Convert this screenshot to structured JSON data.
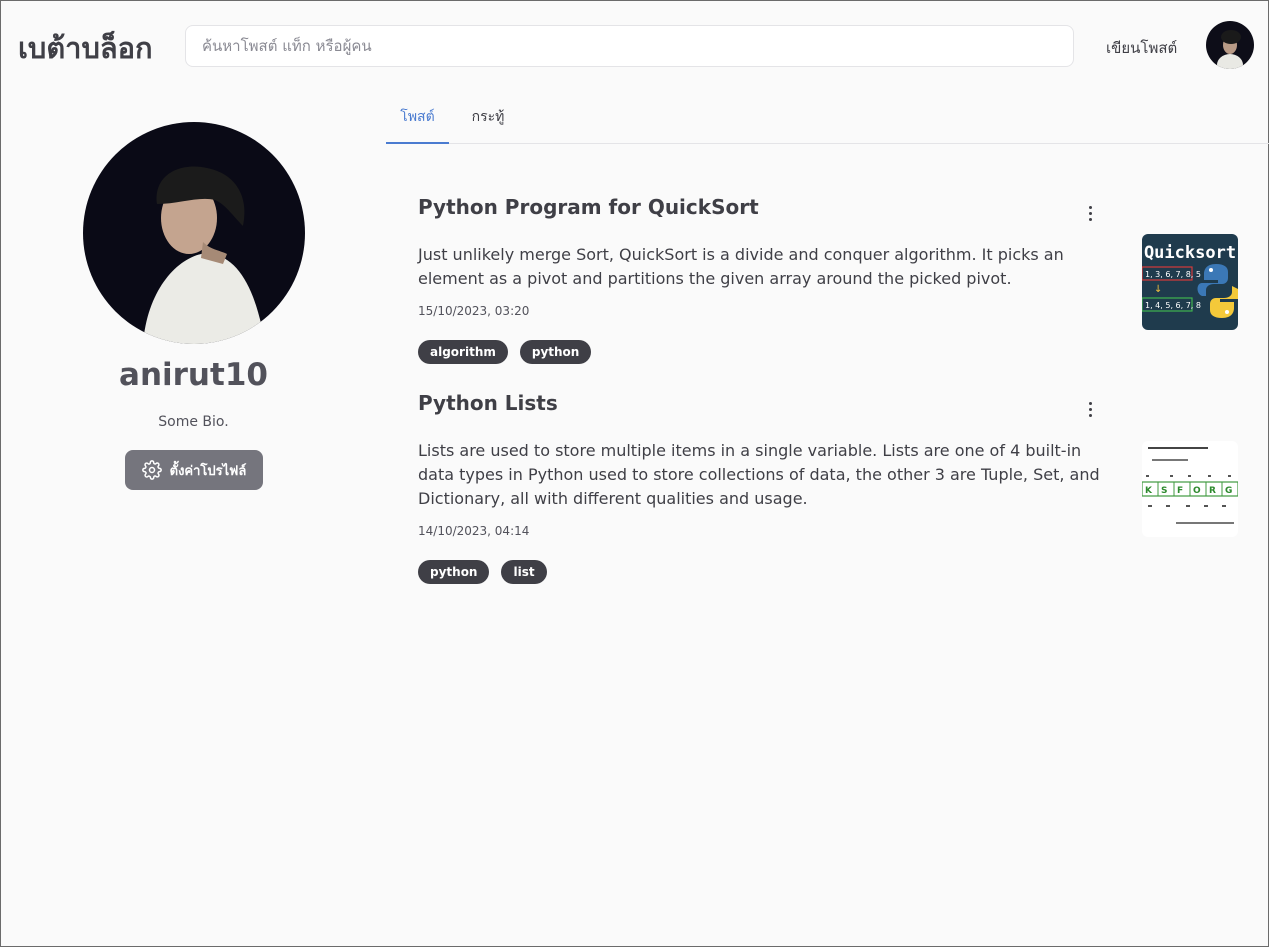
{
  "header": {
    "brand": "เบต้าบล็อก",
    "search_placeholder": "ค้นหาโพสต์ แท็ก หรือผู้คน",
    "write_label": "เขียนโพสต์"
  },
  "profile": {
    "username": "anirut10",
    "bio": "Some Bio.",
    "settings_label": "ตั้งค่าโปรไฟล์"
  },
  "tabs": [
    {
      "label": "โพสต์",
      "active": true
    },
    {
      "label": "กระทู้",
      "active": false
    }
  ],
  "posts": [
    {
      "title": "Python Program for QuickSort",
      "excerpt": "Just unlikely merge Sort, QuickSort is a divide and conquer algorithm. It picks an element as a pivot and partitions the given array around the picked pivot.",
      "date": "15/10/2023, 03:20",
      "tags": [
        "algorithm",
        "python"
      ],
      "thumbnail": {
        "title": "Quicksort",
        "row_top": "1, 3, 6, 7, 8, 5",
        "row_bottom": "1, 4, 5, 6, 7, 8"
      }
    },
    {
      "title": "Python Lists",
      "excerpt": "Lists are used to store multiple items in a single variable. Lists are one of 4 built-in data types in Python used to store collections of data, the other 3 are Tuple, Set, and Dictionary, all with different qualities and usage.",
      "date": "14/10/2023, 04:14",
      "tags": [
        "python",
        "list"
      ],
      "thumbnail": {
        "letters": [
          "K",
          "S",
          "F",
          "O",
          "R",
          "G"
        ]
      }
    }
  ],
  "colors": {
    "accent": "#4a7bd0",
    "tag_bg": "#3f3f46",
    "button_bg": "#75757d",
    "page_bg": "#fafafa"
  }
}
